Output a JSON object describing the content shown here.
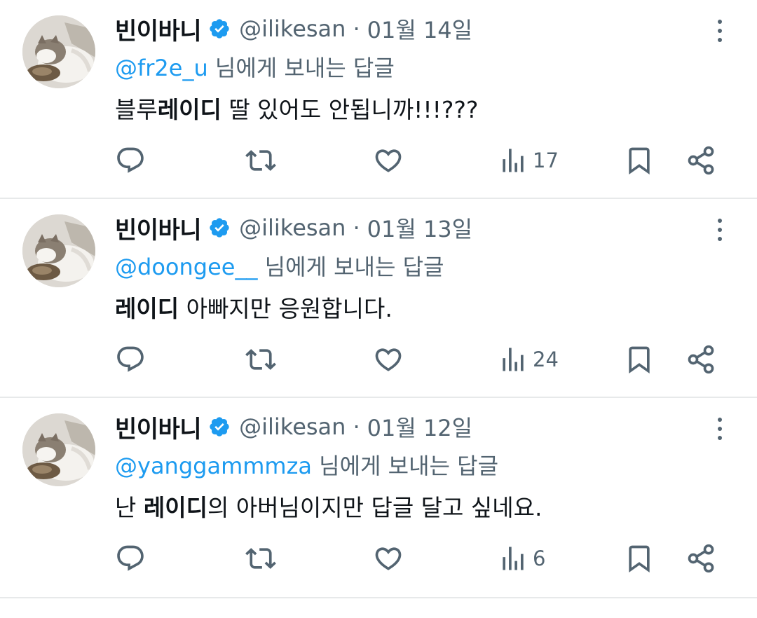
{
  "tweets": [
    {
      "display_name": "빈이바니",
      "handle": "@ilikesan",
      "separator": "·",
      "date": "01월 14일",
      "reply_mention": "@fr2e_u",
      "reply_suffix": " 님에게 보내는 답글",
      "body_pre": "블루",
      "body_bold": "레이디",
      "body_post": " 딸 있어도 안됩니까!!!???",
      "views": "17"
    },
    {
      "display_name": "빈이바니",
      "handle": "@ilikesan",
      "separator": "·",
      "date": "01월 13일",
      "reply_mention": "@doongee__",
      "reply_suffix": " 님에게 보내는 답글",
      "body_pre": "",
      "body_bold": "레이디",
      "body_post": " 아빠지만 응원합니다.",
      "views": "24"
    },
    {
      "display_name": "빈이바니",
      "handle": "@ilikesan",
      "separator": "·",
      "date": "01월 12일",
      "reply_mention": "@yanggammmza",
      "reply_suffix": " 님에게 보내는 답글",
      "body_pre": "난 ",
      "body_bold": "레이디",
      "body_post": "의 아버님이지만 답글 달고 싶네요.",
      "views": "6"
    }
  ],
  "icons": {
    "verified": "verified-badge-icon",
    "more": "more-vertical-icon",
    "reply": "reply-icon",
    "retweet": "retweet-icon",
    "like": "heart-icon",
    "views": "views-icon",
    "bookmark": "bookmark-icon",
    "share": "share-icon"
  },
  "colors": {
    "text_primary": "#0f1419",
    "text_secondary": "#536471",
    "accent": "#1d9bf0",
    "divider": "#e7e9ea"
  }
}
